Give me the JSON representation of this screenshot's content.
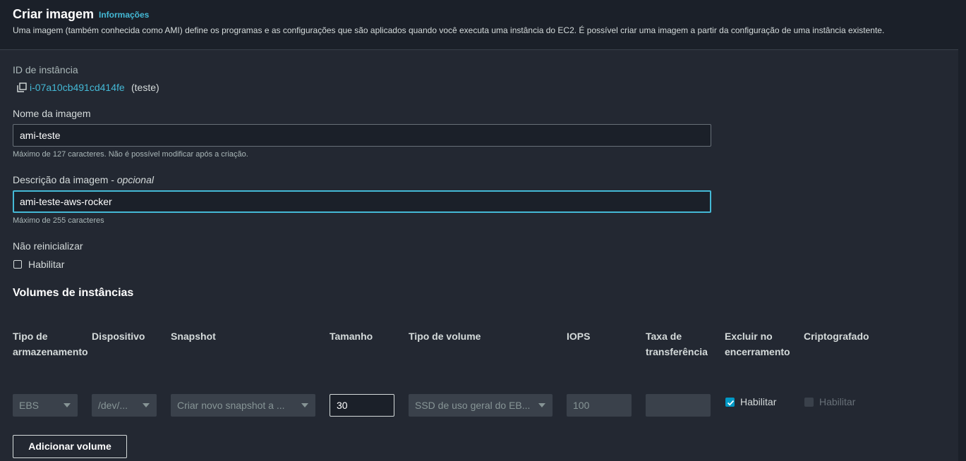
{
  "header": {
    "title": "Criar imagem",
    "info_link": "Informações",
    "description": "Uma imagem (também conhecida como AMI) define os programas e as configurações que são aplicados quando você executa uma instância do EC2. É possível criar uma imagem a partir da configuração de uma instância existente."
  },
  "instance": {
    "label": "ID de instância",
    "id": "i-07a10cb491cd414fe",
    "name": "(teste)"
  },
  "image_name": {
    "label": "Nome da imagem",
    "value": "ami-teste",
    "hint": "Máximo de 127 caracteres. Não é possível modificar após a criação."
  },
  "image_description": {
    "label": "Descrição da imagem - ",
    "label_optional": "opcional",
    "value": "ami-teste-aws-rocker",
    "hint": "Máximo de 255 caracteres"
  },
  "no_reboot": {
    "label": "Não reinicializar",
    "checkbox_label": "Habilitar",
    "checked": false
  },
  "volumes": {
    "title": "Volumes de instâncias",
    "columns": [
      "Tipo de armazenamento",
      "Dispositivo",
      "Snapshot",
      "Tamanho",
      "Tipo de volume",
      "IOPS",
      "Taxa de transferência",
      "Excluir no encerramento",
      "Criptografado"
    ],
    "row": {
      "storage_type": "EBS",
      "device": "/dev/...",
      "snapshot": "Criar novo snapshot a ...",
      "size": "30",
      "volume_type": "SSD de uso geral do EB...",
      "iops": "100",
      "throughput": "",
      "delete_on_termination_label": "Habilitar",
      "delete_on_termination": true,
      "encrypted_label": "Habilitar",
      "encrypted": false
    },
    "add_button": "Adicionar volume"
  },
  "colors": {
    "background": "#232832",
    "header_bg": "#1b2029",
    "link": "#44b9d6",
    "accent": "#0099c6"
  },
  "icons": [
    "copy-icon",
    "caret-down-icon",
    "checkmark-icon"
  ]
}
